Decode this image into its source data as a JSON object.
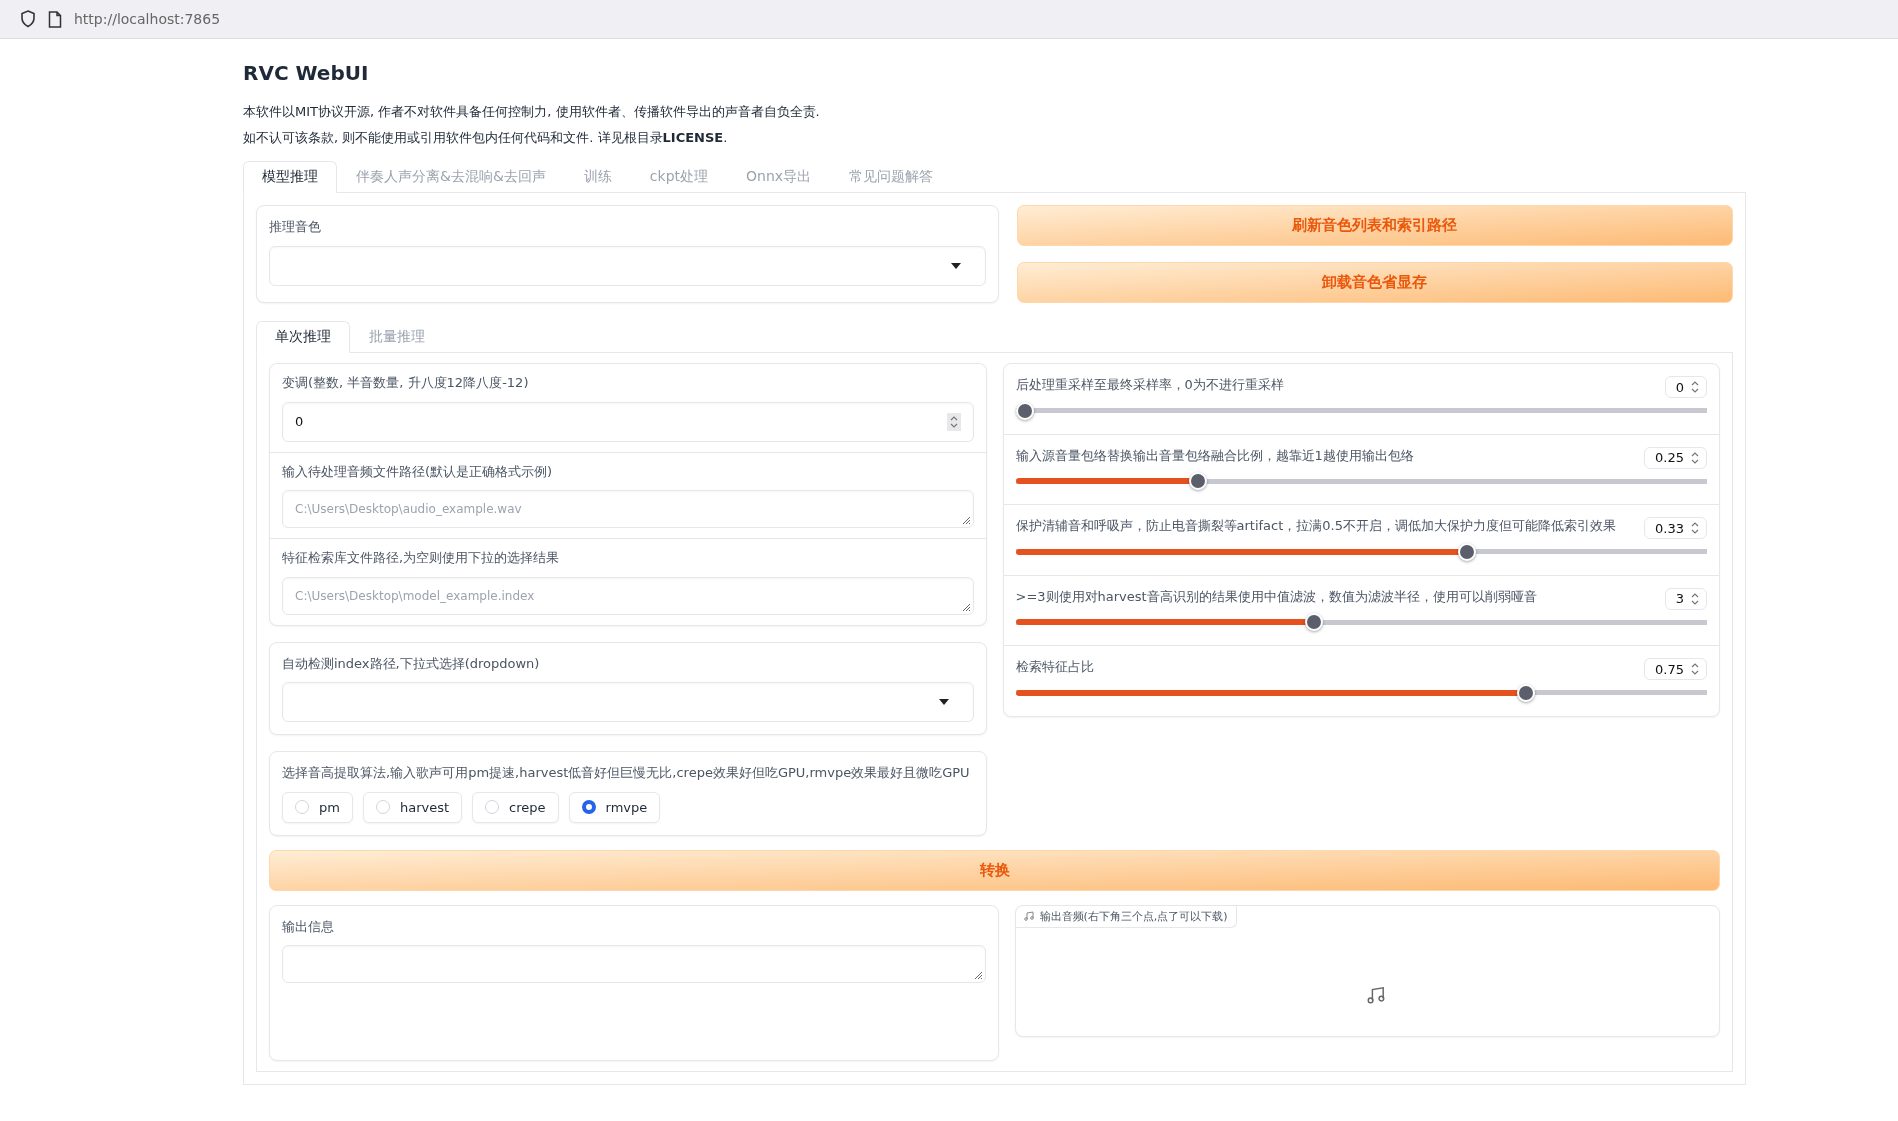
{
  "browser": {
    "url": "http://localhost:7865"
  },
  "title": "RVC WebUI",
  "notice": [
    "本软件以MIT协议开源, 作者不对软件具备任何控制力, 使用软件者、传播软件导出的声音者自负全责.",
    "如不认可该条款, 则不能使用或引用软件包内任何代码和文件. 详见根目录**LICENSE**."
  ],
  "tabs": [
    {
      "label": "模型推理",
      "selected": true
    },
    {
      "label": "伴奏人声分离&去混响&去回声",
      "selected": false
    },
    {
      "label": "训练",
      "selected": false
    },
    {
      "label": "ckpt处理",
      "selected": false
    },
    {
      "label": "Onnx导出",
      "selected": false
    },
    {
      "label": "常见问题解答",
      "selected": false
    }
  ],
  "voice": {
    "label": "推理音色"
  },
  "buttons": [
    "刷新音色列表和索引路径",
    "卸载音色省显存"
  ],
  "sub_tabs": [
    {
      "label": "单次推理",
      "selected": true
    },
    {
      "label": "批量推理",
      "selected": false
    }
  ],
  "transpose": {
    "label": "变调(整数, 半音数量, 升八度12降八度-12)",
    "value": "0"
  },
  "input_path": {
    "label": "输入待处理音频文件路径(默认是正确格式示例)",
    "placeholder": "C:\\Users\\Desktop\\audio_example.wav"
  },
  "index_path": {
    "label": "特征检索库文件路径,为空则使用下拉的选择结果",
    "placeholder": "C:\\Users\\Desktop\\model_example.index"
  },
  "auto_index": {
    "label": "自动检测index路径,下拉式选择(dropdown)"
  },
  "f0_method": {
    "label": "选择音高提取算法,输入歌声可用pm提速,harvest低音好但巨慢无比,crepe效果好但吃GPU,rmvpe效果最好且微吃GPU",
    "options": [
      {
        "label": "pm",
        "selected": false
      },
      {
        "label": "harvest",
        "selected": false
      },
      {
        "label": "crepe",
        "selected": false
      },
      {
        "label": "rmvpe",
        "selected": true
      }
    ]
  },
  "sliders": [
    {
      "label": "后处理重采样至最终采样率，0为不进行重采样",
      "value": "0",
      "level": 0
    },
    {
      "label": "输入源音量包络替换输出音量包络融合比例，越靠近1越使用输出包络",
      "value": "0.25",
      "level": 0.257
    },
    {
      "label": "保护清辅音和呼吸声，防止电音撕裂等artifact，拉满0.5不开启，调低加大保护力度但可能降低索引效果",
      "value": "0.33",
      "level": 0.657
    },
    {
      "label": ">=3则使用对harvest音高识别的结果使用中值滤波，数值为滤波半径，使用可以削弱哑音",
      "value": "3",
      "level": 0.43
    },
    {
      "label": "检索特征占比",
      "value": "0.75",
      "level": 0.744
    }
  ],
  "convert_button": "转换",
  "output_info": {
    "label": "输出信息"
  },
  "output_audio": {
    "label": "输出音频(右下角三个点,点了可以下载)"
  }
}
